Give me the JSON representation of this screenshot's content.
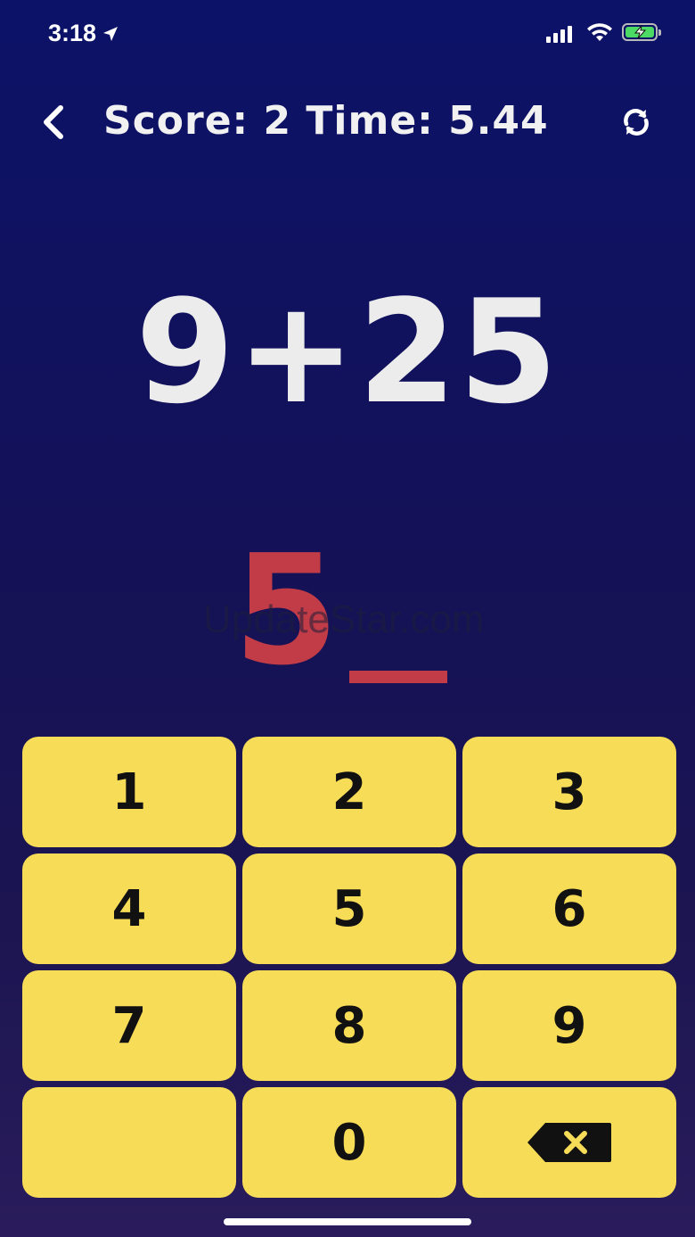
{
  "status_bar": {
    "time": "3:18"
  },
  "header": {
    "score_time": "Score: 2 Time: 5.44"
  },
  "problem": {
    "expression": "9+25"
  },
  "answer": {
    "typed": "5"
  },
  "watermark": "UpdateStar.com",
  "keypad": {
    "keys": [
      "1",
      "2",
      "3",
      "4",
      "5",
      "6",
      "7",
      "8",
      "9",
      "",
      "0"
    ]
  },
  "colors": {
    "key_bg": "#f7dc57",
    "answer": "#c13c46",
    "background_top": "#0c1268"
  }
}
